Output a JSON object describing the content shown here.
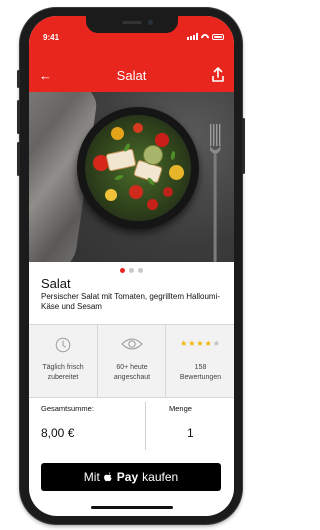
{
  "status_bar": {
    "time": "9:41"
  },
  "nav": {
    "back_icon": "←",
    "title": "Salat",
    "share_icon": "share-icon"
  },
  "hero": {
    "image": "salad-bowl-photo",
    "carousel_total": 3,
    "carousel_active": 1
  },
  "product": {
    "title": "Salat",
    "description": "Persischer Salat mit Tomaten, gegrilltem Halloumi-Käse und Sesam"
  },
  "info": {
    "fresh": {
      "icon": "clock-icon",
      "text": "Täglich frisch zubereitet"
    },
    "views": {
      "icon": "eye-icon",
      "text": "60+ heute angeschaut"
    },
    "rating": {
      "icon": "star-rating",
      "stars": 4,
      "max": 5,
      "count": "158",
      "label": "Bewertungen"
    }
  },
  "order": {
    "total_label": "Gesamtsumme:",
    "total_value": "8,00 €",
    "quantity_label": "Menge",
    "quantity_value": "1"
  },
  "pay_button": {
    "prefix": "Mit",
    "pay_word": "Pay",
    "suffix": "kaufen"
  },
  "colors": {
    "brand_red": "#e8261e",
    "pay_black": "#000000",
    "star_gold": "#f4b400"
  }
}
